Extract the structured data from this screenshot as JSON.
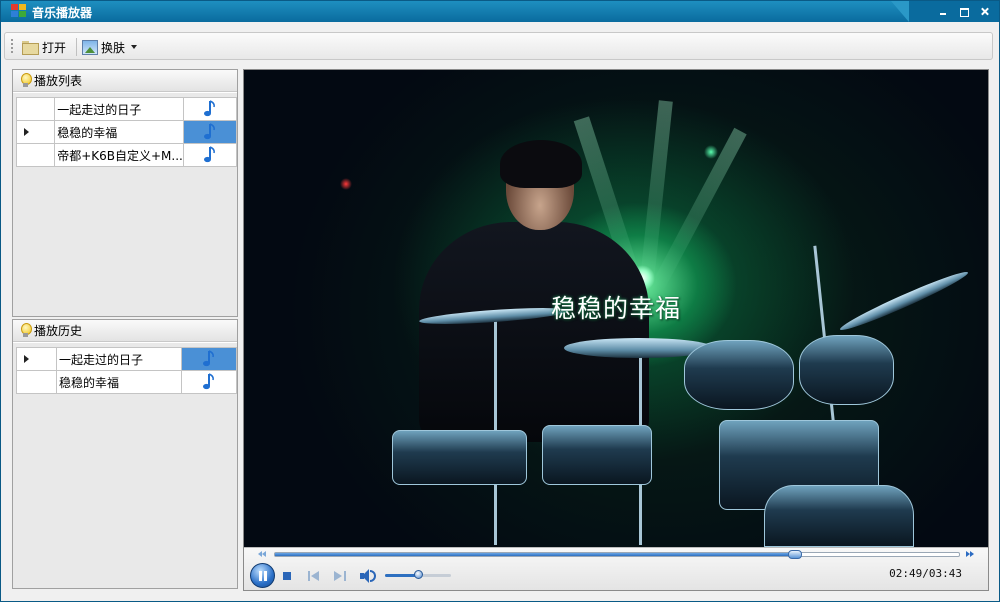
{
  "window": {
    "title": "音乐播放器"
  },
  "toolbar": {
    "open_label": "打开",
    "skin_label": "换肤"
  },
  "playlist": {
    "title": "播放列表",
    "rows": [
      {
        "name": "一起走过的日子",
        "current": false,
        "note_selected": false
      },
      {
        "name": "稳稳的幸福",
        "current": true,
        "note_selected": true
      },
      {
        "name": "帝都+K6B自定义+M...",
        "current": false,
        "note_selected": false
      }
    ]
  },
  "history": {
    "title": "播放历史",
    "rows": [
      {
        "name": "一起走过的日子",
        "current": true,
        "note_selected": true
      },
      {
        "name": "稳稳的幸福",
        "current": false,
        "note_selected": false
      }
    ]
  },
  "player": {
    "lyric": "稳稳的幸福",
    "time_text": "02:49/03:43",
    "progress_fraction": 0.76,
    "volume_fraction": 0.5,
    "state": "playing"
  },
  "colors": {
    "titlebar": "#0a6b9e",
    "selection": "#4a90d6",
    "accent": "#2b70c8"
  },
  "icons": {
    "app": "app-grid-icon",
    "open": "folder-icon",
    "skin": "image-icon",
    "panel": "bulb-icon",
    "row": "music-note-icon"
  }
}
